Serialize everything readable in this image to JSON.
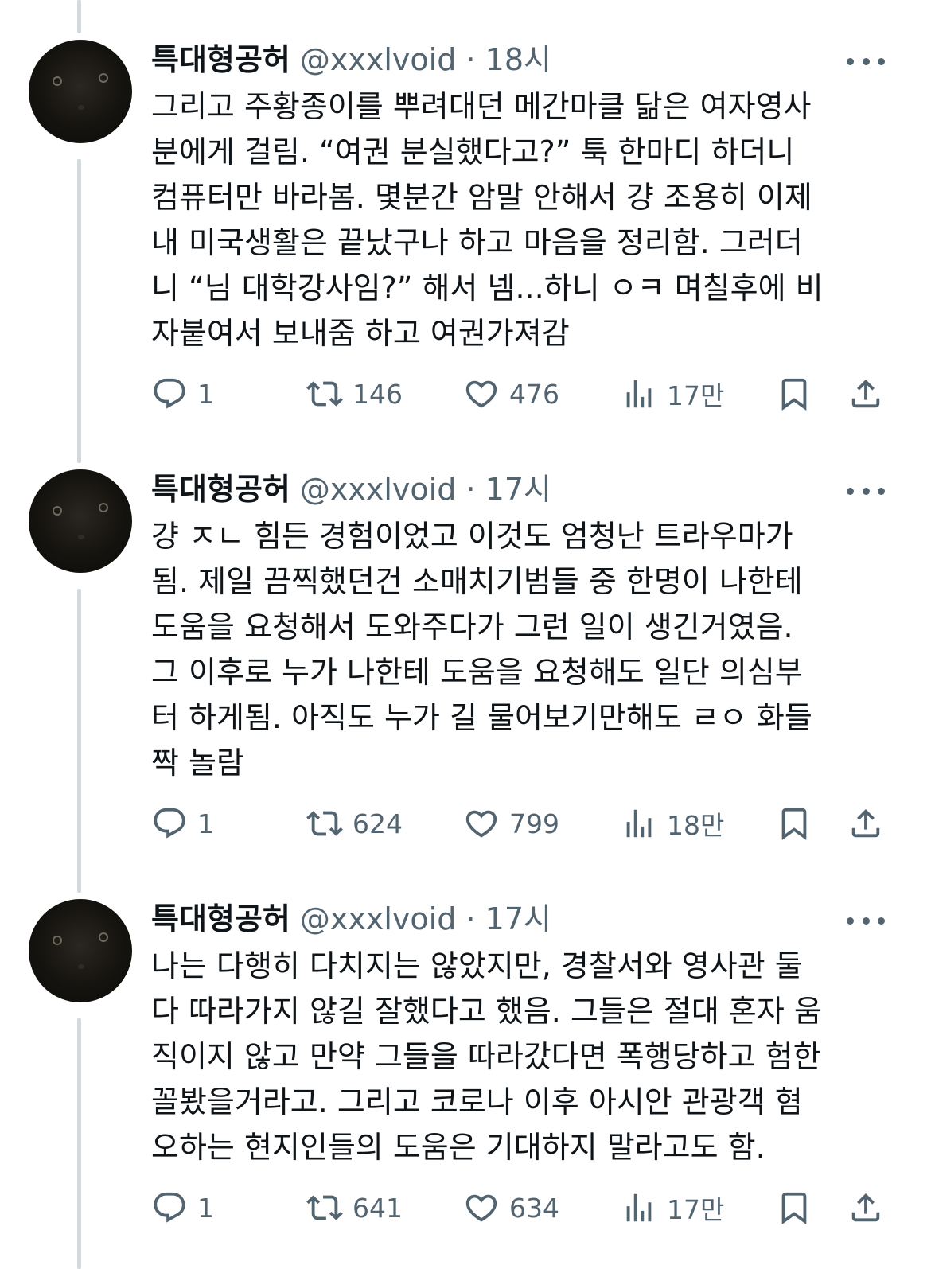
{
  "tweets": [
    {
      "display_name": "특대형공허",
      "handle": "@xxxlvoid",
      "separator": "·",
      "time": "18시",
      "text": "그리고 주황종이를 뿌려대던 메간마클 닮은 여자영사\n분에게 걸림. “여권 분실했다고?” 툭 한마디 하더니\n컴퓨터만 바라봄. 몇분간 암말 안해서 걍 조용히 이제\n내 미국생활은 끝났구나 하고 마음을 정리함. 그러더\n니 “님 대학강사임?” 해서 넴...하니 ㅇㅋ 며칠후에 비\n자붙여서 보내줌 하고 여권가져감",
      "stats": {
        "replies": "1",
        "retweets": "146",
        "likes": "476",
        "views": "17만"
      }
    },
    {
      "display_name": "특대형공허",
      "handle": "@xxxlvoid",
      "separator": "·",
      "time": "17시",
      "text": "걍 ㅈㄴ 힘든 경험이었고 이것도 엄청난 트라우마가\n됨. 제일 끔찍했던건 소매치기범들 중 한명이 나한테\n도움을 요청해서 도와주다가 그런 일이 생긴거였음.\n그 이후로 누가 나한테 도움을 요청해도 일단 의심부\n터 하게됨. 아직도 누가 길 물어보기만해도 ㄹㅇ 화들\n짝 놀람",
      "stats": {
        "replies": "1",
        "retweets": "624",
        "likes": "799",
        "views": "18만"
      }
    },
    {
      "display_name": "특대형공허",
      "handle": "@xxxlvoid",
      "separator": "·",
      "time": "17시",
      "text": "나는 다행히 다치지는 않았지만, 경찰서와 영사관 둘\n다 따라가지 않길 잘했다고 했음. 그들은 절대 혼자 움\n직이지 않고 만약 그들을 따라갔다면 폭행당하고 험한\n꼴봤을거라고. 그리고 코로나 이후 아시안 관광객 혐\n오하는 현지인들의 도움은 기대하지 말라고도 함.",
      "stats": {
        "replies": "1",
        "retweets": "641",
        "likes": "634",
        "views": "17만"
      }
    }
  ],
  "icons": {
    "reply": "reply-icon",
    "retweet": "retweet-icon",
    "like": "heart-icon",
    "views": "views-icon",
    "bookmark": "bookmark-icon",
    "share": "share-icon",
    "more": "more-icon"
  },
  "colors": {
    "primary_text": "#0f1419",
    "secondary_text": "#536471",
    "thread_line": "#cfd9de",
    "background": "#ffffff"
  }
}
